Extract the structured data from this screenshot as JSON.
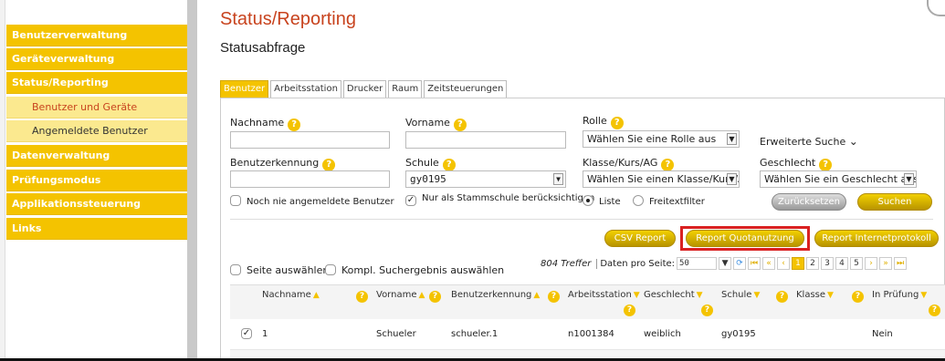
{
  "sidebar": {
    "items": [
      {
        "label": "Benutzerverwaltung"
      },
      {
        "label": "Geräteverwaltung"
      },
      {
        "label": "Status/Reporting"
      },
      {
        "label": "Datenverwaltung"
      },
      {
        "label": "Prüfungsmodus"
      },
      {
        "label": "Applikationssteuerung"
      },
      {
        "label": "Links"
      }
    ],
    "subitems": [
      {
        "label": "Benutzer und Geräte"
      },
      {
        "label": "Angemeldete Benutzer"
      }
    ]
  },
  "header": {
    "title": "Status/Reporting",
    "subtitle": "Statusabfrage"
  },
  "tabs": [
    {
      "label": "Benutzer"
    },
    {
      "label": "Arbeitsstation"
    },
    {
      "label": "Drucker"
    },
    {
      "label": "Raum"
    },
    {
      "label": "Zeitsteuerungen"
    }
  ],
  "form": {
    "nachname_label": "Nachname",
    "vorname_label": "Vorname",
    "rolle_label": "Rolle",
    "rolle_value": "Wählen Sie eine Rolle aus",
    "erweiterte_suche": "Erweiterte Suche",
    "benutzerkennung_label": "Benutzerkennung",
    "schule_label": "Schule",
    "schule_value": "gy0195",
    "klasse_label": "Klasse/Kurs/AG",
    "klasse_value": "Wählen Sie einen Klasse/Kurs/A",
    "geschlecht_label": "Geschlecht",
    "geschlecht_value": "Wählen Sie ein Geschlecht aus",
    "noch_nie_label": "Noch nie angemeldete Benutzer",
    "stammschule_label": "Nur als Stammschule berücksichtigen",
    "liste_label": "Liste",
    "freitext_label": "Freitextfilter",
    "reset_label": "Zurücksetzen",
    "search_label": "Suchen"
  },
  "reports": {
    "csv": "CSV Report",
    "quota": "Report Quotanutzung",
    "internet": "Report Internetprotokoll"
  },
  "results": {
    "seite_auswaehlen": "Seite auswählen",
    "kompl_auswaehlen": "Kompl. Suchergebnis auswählen",
    "hits": "804 Treffer",
    "per_page_label": "Daten pro Seite:",
    "per_page_value": "50",
    "pages": [
      "1",
      "2",
      "3",
      "4",
      "5"
    ]
  },
  "table": {
    "headers": [
      "Nachname",
      "Vorname",
      "Benutzerkennung",
      "Arbeitsstation",
      "Geschlecht",
      "Schule",
      "Klasse",
      "In Prüfung"
    ],
    "rows": [
      [
        "1",
        "Schueler",
        "schueler.1",
        "n1001384",
        "weiblich",
        "gy0195",
        "",
        "Nein"
      ]
    ]
  },
  "colors": {
    "accent": "#f4c300",
    "title": "#c8431e",
    "highlight": "#d92121"
  }
}
